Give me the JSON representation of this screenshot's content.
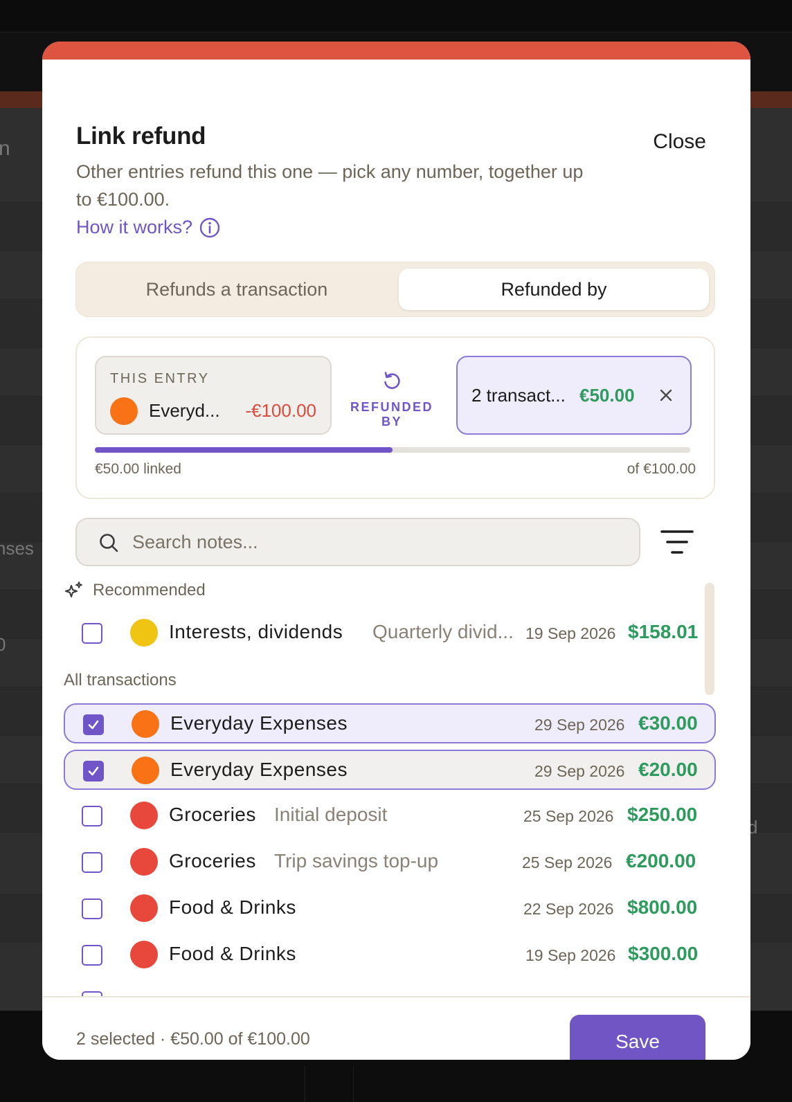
{
  "background": {
    "partial_texts": [
      "n",
      "nses",
      "0",
      "d"
    ]
  },
  "modal": {
    "title": "Link refund",
    "close_label": "Close",
    "subtitle": "Other entries refund this one — pick any number, together up to €100.00.",
    "how_link": "How it works?",
    "tabs": [
      {
        "label": "Refunds a transaction",
        "active": false
      },
      {
        "label": "Refunded by",
        "active": true
      }
    ],
    "link_card": {
      "entry_label": "THIS ENTRY",
      "entry_name": "Everyd...",
      "entry_amount": "-€100.00",
      "entry_color": "#f97316",
      "connector_label": "REFUNDED BY",
      "linked_text": "2 transact...",
      "linked_amount": "€50.00",
      "progress_fraction": 0.5,
      "progress_left": "€50.00 linked",
      "progress_right": "of €100.00"
    },
    "search": {
      "placeholder": "Search notes..."
    },
    "recommended_label": "Recommended",
    "all_label": "All transactions",
    "recommended": [
      {
        "category": "Interests, dividends",
        "note": "Quarterly divid...",
        "date": "19 Sep 2026",
        "amount": "$158.01",
        "color": "#f0c413",
        "checked": false
      }
    ],
    "transactions": [
      {
        "category": "Everyday Expenses",
        "note": "",
        "date": "29 Sep 2026",
        "amount": "€30.00",
        "color": "#f97316",
        "checked": true
      },
      {
        "category": "Everyday Expenses",
        "note": "",
        "date": "29 Sep 2026",
        "amount": "€20.00",
        "color": "#f97316",
        "checked": true
      },
      {
        "category": "Groceries",
        "note": "Initial deposit",
        "date": "25 Sep 2026",
        "amount": "$250.00",
        "color": "#e8483c",
        "checked": false
      },
      {
        "category": "Groceries",
        "note": "Trip savings top-up",
        "date": "25 Sep 2026",
        "amount": "€200.00",
        "color": "#e8483c",
        "checked": false
      },
      {
        "category": "Food & Drinks",
        "note": "",
        "date": "22 Sep 2026",
        "amount": "$800.00",
        "color": "#e8483c",
        "checked": false
      },
      {
        "category": "Food & Drinks",
        "note": "",
        "date": "19 Sep 2026",
        "amount": "$300.00",
        "color": "#e8483c",
        "checked": false
      }
    ],
    "footer_text": "2 selected · €50.00 of €100.00",
    "save_label": "Save"
  }
}
